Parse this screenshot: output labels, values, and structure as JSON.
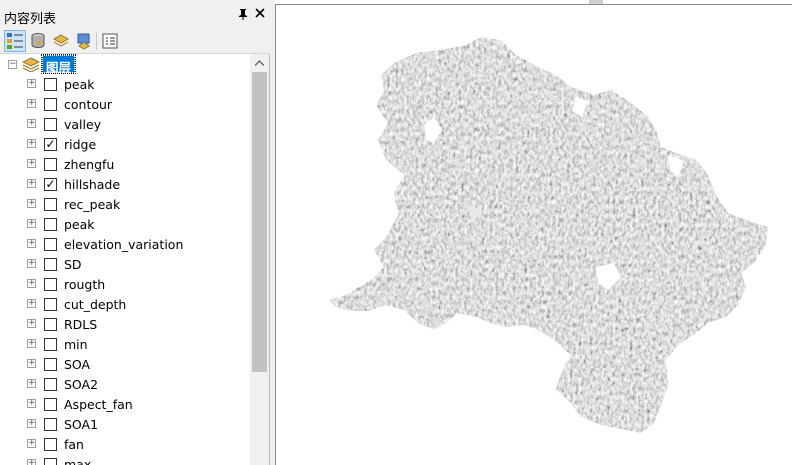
{
  "toc": {
    "title": "内容列表",
    "pin_glyph": "ᵖ",
    "close_glyph": "✕",
    "toolbar": [
      {
        "name": "list-by-drawing-order",
        "icon": "list-by-drawing-order-icon",
        "active": true
      },
      {
        "name": "list-by-source",
        "icon": "list-by-source-icon",
        "active": false
      },
      {
        "name": "list-by-visibility",
        "icon": "list-by-visibility-icon",
        "active": false
      },
      {
        "name": "list-by-selection",
        "icon": "list-by-selection-icon",
        "active": false
      },
      {
        "name": "options",
        "icon": "options-icon",
        "active": false
      }
    ],
    "root": {
      "label": "图层",
      "expander": "−"
    },
    "layers": [
      {
        "label": "peak",
        "checked": false
      },
      {
        "label": "contour",
        "checked": false
      },
      {
        "label": "valley",
        "checked": false
      },
      {
        "label": "ridge",
        "checked": true
      },
      {
        "label": "zhengfu",
        "checked": false
      },
      {
        "label": "hillshade",
        "checked": true
      },
      {
        "label": "rec_peak",
        "checked": false
      },
      {
        "label": "peak",
        "checked": false
      },
      {
        "label": "elevation_variation",
        "checked": false
      },
      {
        "label": "SD",
        "checked": false
      },
      {
        "label": "rougth",
        "checked": false
      },
      {
        "label": "cut_depth",
        "checked": false
      },
      {
        "label": "RDLS",
        "checked": false
      },
      {
        "label": "min",
        "checked": false
      },
      {
        "label": "SOA",
        "checked": false
      },
      {
        "label": "SOA2",
        "checked": false
      },
      {
        "label": "Aspect_fan",
        "checked": false
      },
      {
        "label": "SOA1",
        "checked": false
      },
      {
        "label": "fan",
        "checked": false
      },
      {
        "label": "max",
        "checked": false
      }
    ]
  },
  "map": {
    "content": "hillshade-raster",
    "colors": {
      "dark": "#1a1a1a",
      "light": "#e8e8e8",
      "mid": "#6e6e6e"
    }
  },
  "colors": {
    "selection": "#0078d7",
    "panel_bg": "#f0f0f0"
  }
}
